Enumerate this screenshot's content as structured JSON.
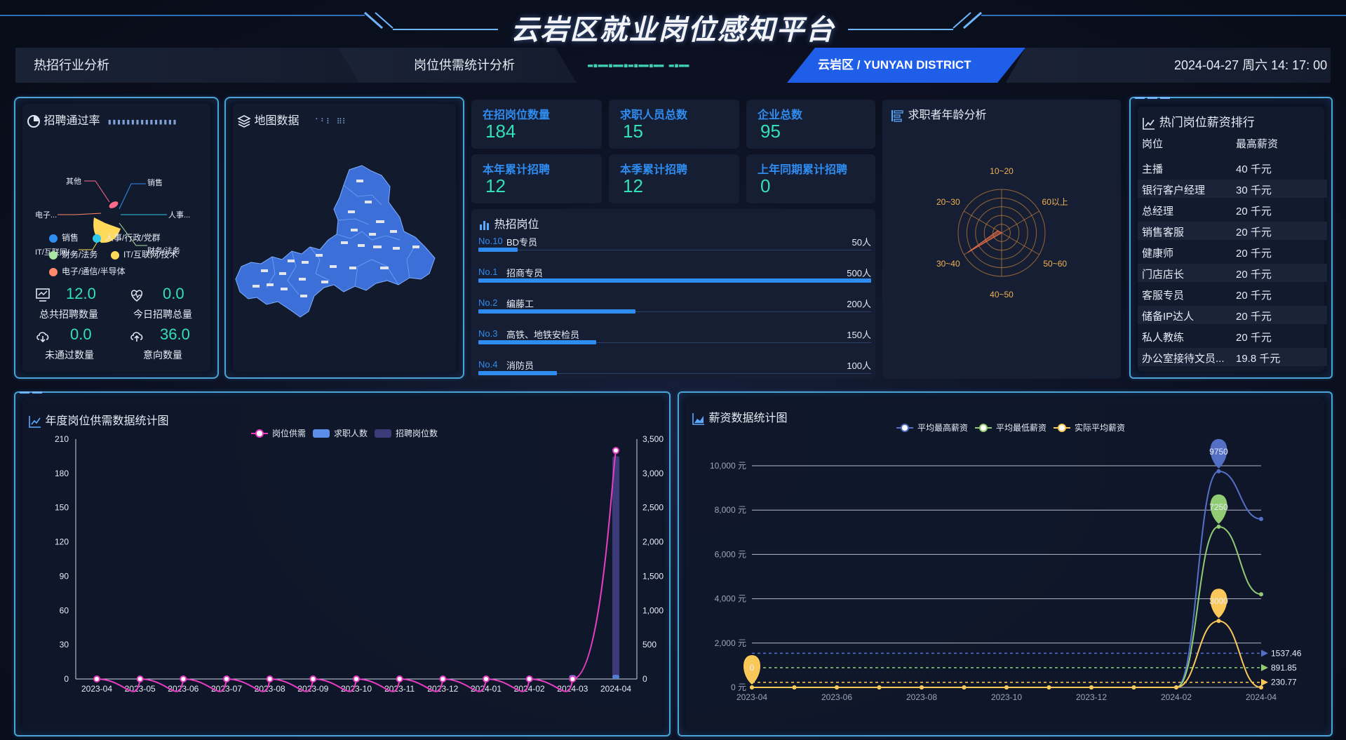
{
  "header": {
    "title": "云岩区就业岗位感知平台",
    "nav": [
      "热招行业分析",
      "岗位供需统计分析"
    ],
    "region": "云岩区 / YUNYAN DISTRICT",
    "datetime": "2024-04-27 周六 14: 17: 00"
  },
  "pass_rate": {
    "title": "招聘通过率",
    "pie_labels": [
      "其他",
      "销售",
      "电子...",
      "人事...",
      "IT/互联网/...",
      "财务/法务"
    ],
    "legend": [
      {
        "label": "销售",
        "color": "#2f8cf0"
      },
      {
        "label": "人事/行政/党群",
        "color": "#2ec7ea"
      },
      {
        "label": "财务/法务",
        "color": "#a8e6a1"
      },
      {
        "label": "IT/互联网/技术",
        "color": "#ffd95a"
      },
      {
        "label": "电子/通信/半导体",
        "color": "#ff8a6b"
      }
    ],
    "kpis": [
      {
        "label": "总共招聘数量",
        "value": "12.0",
        "icon": "monitor-chart-icon"
      },
      {
        "label": "今日招聘总量",
        "value": "0.0",
        "icon": "heartbeat-icon"
      },
      {
        "label": "未通过数量",
        "value": "0.0",
        "icon": "cloud-download-icon"
      },
      {
        "label": "意向数量",
        "value": "36.0",
        "icon": "cloud-upload-icon"
      }
    ]
  },
  "map": {
    "title": "地图数据"
  },
  "stats": [
    {
      "label": "在招岗位数量",
      "value": "184"
    },
    {
      "label": "求职人员总数",
      "value": "15"
    },
    {
      "label": "企业总数",
      "value": "95"
    },
    {
      "label": "本年累计招聘",
      "value": "12"
    },
    {
      "label": "本季累计招聘",
      "value": "12"
    },
    {
      "label": "上年同期累计招聘",
      "value": "0"
    }
  ],
  "hot_jobs": {
    "title": "热招岗位",
    "max": 500,
    "items": [
      {
        "rank": "No.10",
        "name": "BD专员",
        "count_label": "50人",
        "count": 50
      },
      {
        "rank": "No.1",
        "name": "招商专员",
        "count_label": "500人",
        "count": 500
      },
      {
        "rank": "No.2",
        "name": "编藤工",
        "count_label": "200人",
        "count": 200
      },
      {
        "rank": "No.3",
        "name": "高铁、地铁安检员",
        "count_label": "150人",
        "count": 150
      },
      {
        "rank": "No.4",
        "name": "消防员",
        "count_label": "100人",
        "count": 100
      }
    ]
  },
  "age": {
    "title": "求职者年龄分析",
    "labels": [
      "10~20",
      "60以上",
      "50~60",
      "40~50",
      "30~40",
      "20~30"
    ],
    "values": [
      0,
      0,
      0,
      0,
      0.9,
      0.1
    ]
  },
  "salary_rank": {
    "title": "热门岗位薪资排行",
    "headers": [
      "岗位",
      "最高薪资"
    ],
    "rows": [
      [
        "主播",
        "40 千元"
      ],
      [
        "银行客户经理",
        "30 千元"
      ],
      [
        "总经理",
        "20 千元"
      ],
      [
        "销售客服",
        "20 千元"
      ],
      [
        "健康师",
        "20 千元"
      ],
      [
        "门店店长",
        "20 千元"
      ],
      [
        "客服专员",
        "20 千元"
      ],
      [
        "储备IP达人",
        "20 千元"
      ],
      [
        "私人教练",
        "20 千元"
      ],
      [
        "办公室接待文员...",
        "19.8 千元"
      ]
    ]
  },
  "chart_data": [
    {
      "type": "line",
      "title": "年度岗位供需数据统计图",
      "legend": [
        "岗位供需",
        "求职人数",
        "招聘岗位数"
      ],
      "categories": [
        "2023-04",
        "2023-05",
        "2023-06",
        "2023-07",
        "2023-08",
        "2023-09",
        "2023-10",
        "2023-11",
        "2023-12",
        "2024-01",
        "2024-02",
        "2024-03",
        "2024-04"
      ],
      "y_left_ticks": [
        0,
        30,
        60,
        90,
        120,
        150,
        180,
        210
      ],
      "y_right_ticks": [
        "0",
        "500",
        "1,000",
        "1,500",
        "2,000",
        "2,500",
        "3,000",
        "3,500"
      ],
      "ylim_left": [
        0,
        210
      ],
      "ylim_right": [
        0,
        3500
      ],
      "series": [
        {
          "name": "岗位供需",
          "axis": "left",
          "values": [
            0,
            0,
            0,
            0,
            0,
            0,
            0,
            0,
            0,
            0,
            0,
            0,
            200
          ],
          "color": "#e83ec3"
        },
        {
          "name": "求职人数",
          "axis": "right",
          "values": [
            0,
            0,
            0,
            0,
            0,
            0,
            0,
            0,
            0,
            0,
            0,
            15,
            20
          ],
          "color": "#5b8ee6"
        },
        {
          "name": "招聘岗位数",
          "axis": "right",
          "values": [
            0,
            0,
            0,
            0,
            0,
            0,
            0,
            0,
            0,
            0,
            0,
            60,
            3250
          ],
          "color": "#3d3a7a"
        }
      ]
    },
    {
      "type": "line",
      "title": "薪资数据统计图",
      "legend": [
        "平均最高薪资",
        "平均最低薪资",
        "实际平均薪资"
      ],
      "categories": [
        "2023-04",
        "2023-05",
        "2023-06",
        "2023-07",
        "2023-08",
        "2023-09",
        "2023-10",
        "2023-11",
        "2023-12",
        "2024-01",
        "2024-02",
        "2024-03",
        "2024-04"
      ],
      "x_tick_labels": [
        "2023-04",
        "2023-06",
        "2023-08",
        "2023-10",
        "2023-12",
        "2024-02",
        "2024-04"
      ],
      "y_ticks": [
        "0 元",
        "2,000 元",
        "4,000 元",
        "6,000 元",
        "8,000 元",
        "10,000 元"
      ],
      "ylim": [
        0,
        10000
      ],
      "series": [
        {
          "name": "平均最高薪资",
          "values": [
            0,
            0,
            0,
            0,
            0,
            0,
            0,
            0,
            0,
            0,
            0,
            9750,
            7600
          ],
          "color": "#5470c6",
          "max_label": "9750",
          "avg_label": "1537.46",
          "avg": 1537.46
        },
        {
          "name": "平均最低薪资",
          "values": [
            0,
            0,
            0,
            0,
            0,
            0,
            0,
            0,
            0,
            0,
            0,
            7250,
            4200
          ],
          "color": "#91cc75",
          "max_label": "7250",
          "avg_label": "891.85",
          "avg": 891.85
        },
        {
          "name": "实际平均薪资",
          "values": [
            0,
            0,
            0,
            0,
            0,
            0,
            0,
            0,
            0,
            0,
            0,
            3000,
            0
          ],
          "color": "#fac858",
          "max_label": "3000",
          "min_label": "0",
          "avg_label": "230.77",
          "avg": 230.77
        }
      ]
    }
  ]
}
